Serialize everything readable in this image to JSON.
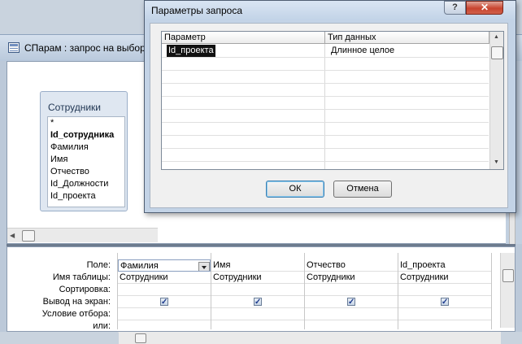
{
  "query_window": {
    "title": "СПарам : запрос на выбор",
    "table": {
      "name": "Сотрудники",
      "fields": [
        "*",
        "Id_сотрудника",
        "Фамилия",
        "Имя",
        "Отчество",
        "Id_Должности",
        "Id_проекта"
      ]
    },
    "grid": {
      "row_labels": [
        "Поле:",
        "Имя таблицы:",
        "Сортировка:",
        "Вывод на экран:",
        "Условие отбора:",
        "или:"
      ],
      "columns": [
        {
          "field": "Фамилия",
          "table": "Сотрудники",
          "show": true
        },
        {
          "field": "Имя",
          "table": "Сотрудники",
          "show": true
        },
        {
          "field": "Отчество",
          "table": "Сотрудники",
          "show": true
        },
        {
          "field": "Id_проекта",
          "table": "Сотрудники",
          "show": true
        }
      ]
    }
  },
  "dialog": {
    "title": "Параметры запроса",
    "help_label": "?",
    "close_label": "✕",
    "headers": {
      "param": "Параметр",
      "type": "Тип данных"
    },
    "rows": [
      {
        "param": "Id_проекта",
        "type": "Длинное целое"
      }
    ],
    "ok_label": "ОК",
    "cancel_label": "Отмена"
  }
}
